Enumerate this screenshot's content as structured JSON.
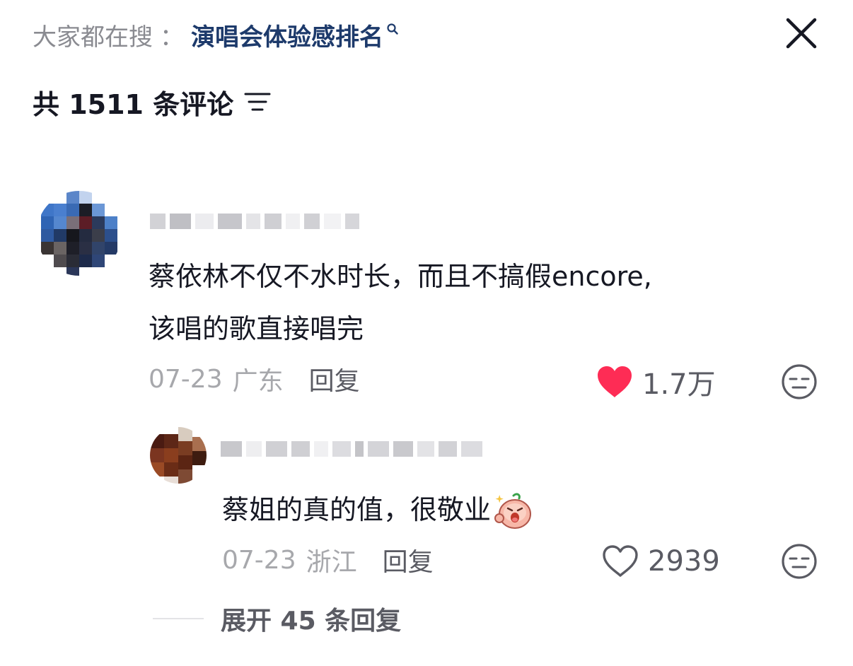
{
  "header": {
    "search_prefix": "大家都在搜",
    "search_separator": "：",
    "search_term": "演唱会体验感排名",
    "search_icon": "search-icon",
    "close_icon": "close-icon"
  },
  "comments_header": {
    "count_label": "共 1511 条评论",
    "sort_icon": "sort-icon"
  },
  "comments": [
    {
      "text_line1": "蔡依林不仅不水时长，而且不搞假encore,",
      "text_line2": "该唱的歌直接唱完",
      "date": "07-23",
      "region": "广东",
      "reply_label": "回复",
      "like_count": "1.7万",
      "liked": true,
      "like_color": "#fe2c55"
    },
    {
      "text": "蔡姐的真的值，很敬业",
      "emoji": "shouting-peach-emoji",
      "date": "07-23",
      "region": "浙江",
      "reply_label": "回复",
      "like_count": "2939",
      "liked": false
    }
  ],
  "expand_replies": {
    "label": "展开 45 条回复"
  }
}
